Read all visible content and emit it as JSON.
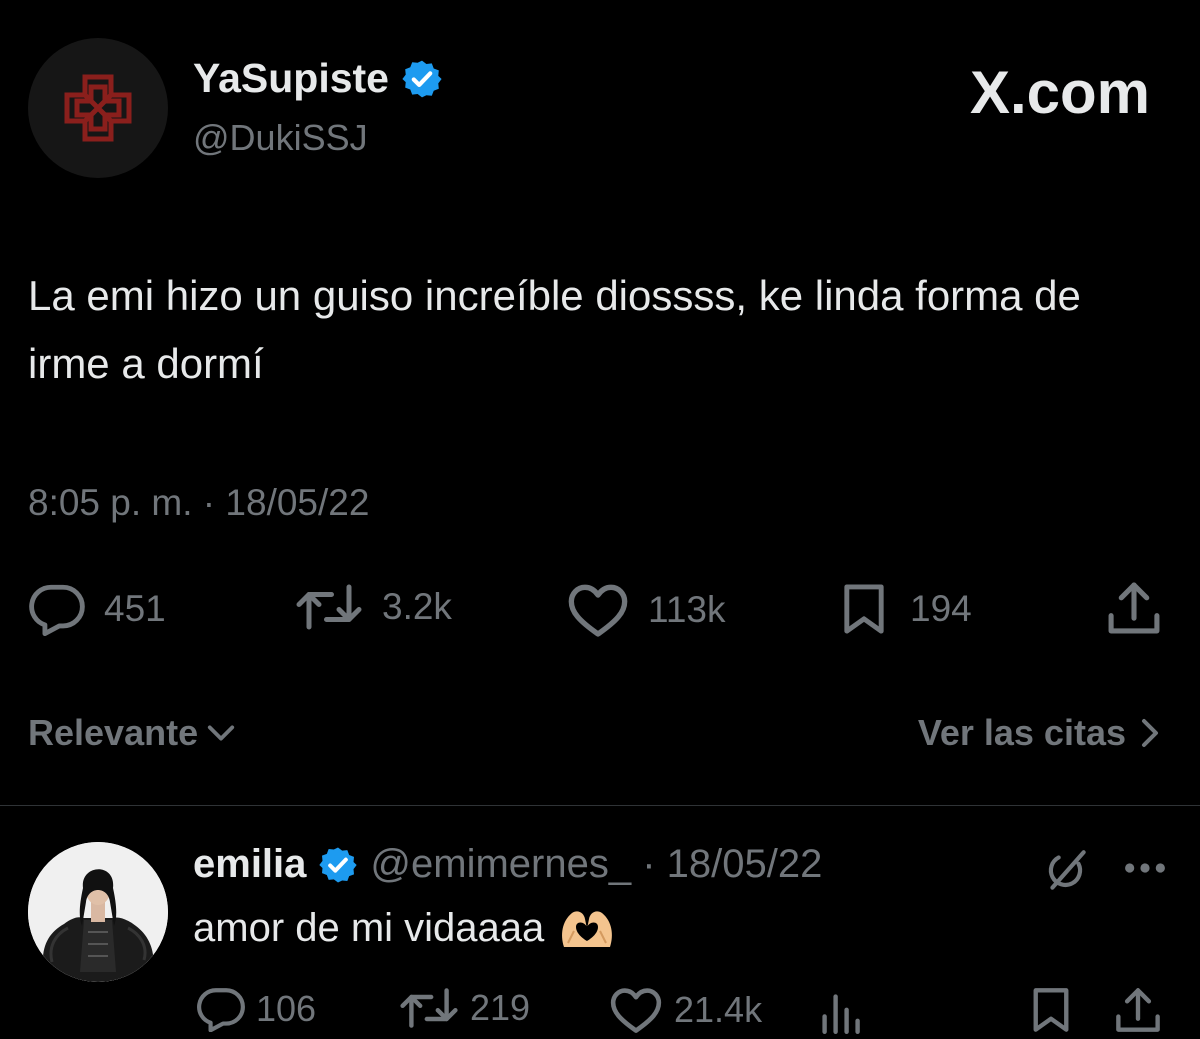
{
  "tweet": {
    "author_name": "YaSupiste",
    "author_handle": "@DukiSSJ",
    "brand": "X.com",
    "text": "La emi hizo un guiso increíble diossss, ke linda forma de irme a dormí",
    "timestamp": "8:05 p. m. · 18/05/22",
    "stats": {
      "replies": "451",
      "reposts": "3.2k",
      "likes": "113k",
      "bookmarks": "194"
    }
  },
  "sort": {
    "label": "Relevante",
    "quotes_link": "Ver las citas"
  },
  "reply": {
    "author_name": "emilia",
    "handle_date": "@emimernes_ · 18/05/22",
    "text": "amor de mi vidaaaa",
    "stats": {
      "replies": "106",
      "reposts": "219",
      "likes": "21.4k"
    }
  },
  "colors": {
    "background": "#000000",
    "text_primary": "#e7e9ea",
    "text_secondary": "#71767b",
    "verified": "#1d9bf0",
    "divider": "#2f3336"
  },
  "icons": {
    "reply": "speech-bubble-icon",
    "repost": "repost-arrows-icon",
    "like": "heart-icon",
    "bookmark": "bookmark-icon",
    "share": "share-upload-icon",
    "views": "bar-chart-icon",
    "grok": "grok-slash-icon",
    "more": "more-dots-icon",
    "verified": "verified-badge-icon"
  }
}
